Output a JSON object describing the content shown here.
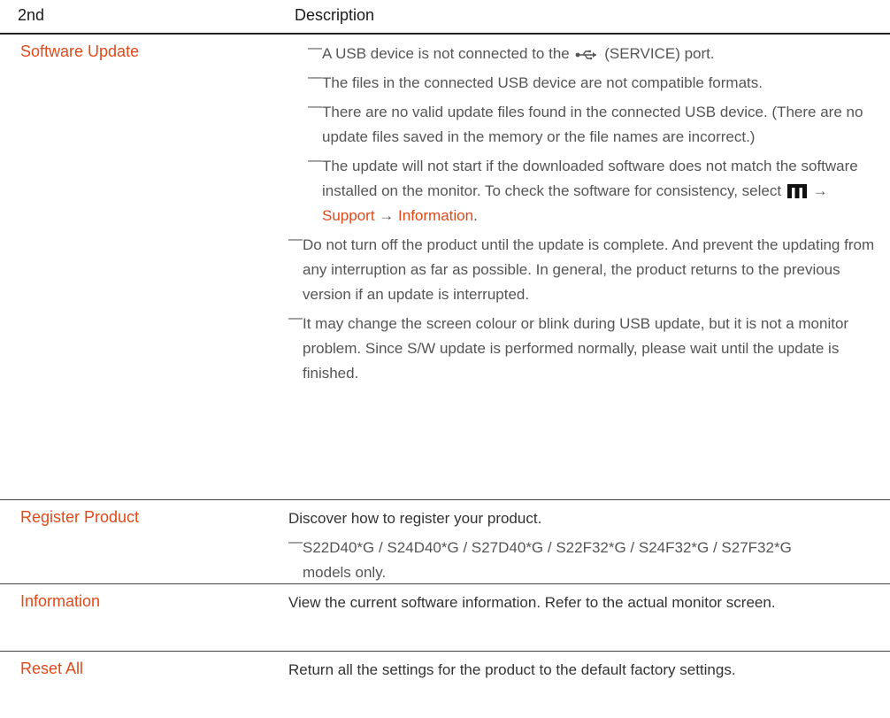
{
  "header": {
    "col1": "2nd",
    "col2": "Description"
  },
  "rows": [
    {
      "label": "Software Update",
      "notes_indented": [
        {
          "pre": "A USB device is not connected to the",
          "post": "(SERVICE) port.",
          "icon": "usb-icon"
        },
        {
          "text": "The files in the connected USB device are not compatible formats."
        },
        {
          "text": "There are no valid update files found in the connected USB device. (There are no update files saved in the memory or the file names are incorrect.)"
        },
        {
          "pre": "The update will not start if the downloaded software does not match the software installed on the monitor. To check the software for consistency, select",
          "icon": "menu-icon",
          "arrow1": "→",
          "link1": "Support",
          "arrow2": "→",
          "link2": "Information",
          "end": "."
        }
      ],
      "notes": [
        "Do not turn off the product until the update is complete. And prevent the updating from any interruption as far as possible. In general, the product returns to the previous version if an update is interrupted.",
        "It may change the screen colour or blink during USB update, but it is not a monitor problem. Since S/W update is performed normally, please wait until the update is finished."
      ]
    },
    {
      "label": "Register Product",
      "description": "Discover how to register your product.",
      "notes": [
        "S22D40*G / S24D40*G / S27D40*G / S22F32*G / S24F32*G / S27F32*G models only."
      ]
    },
    {
      "label": "Information",
      "description": "View the current software information. Refer to the actual monitor screen."
    },
    {
      "label": "Reset All",
      "description": "Return all the settings for the product to the default factory settings."
    }
  ],
  "dash_glyph": "―",
  "colors": {
    "accent": "#e04a1a",
    "text": "#333333",
    "note": "#555555",
    "rule": "#222222"
  }
}
